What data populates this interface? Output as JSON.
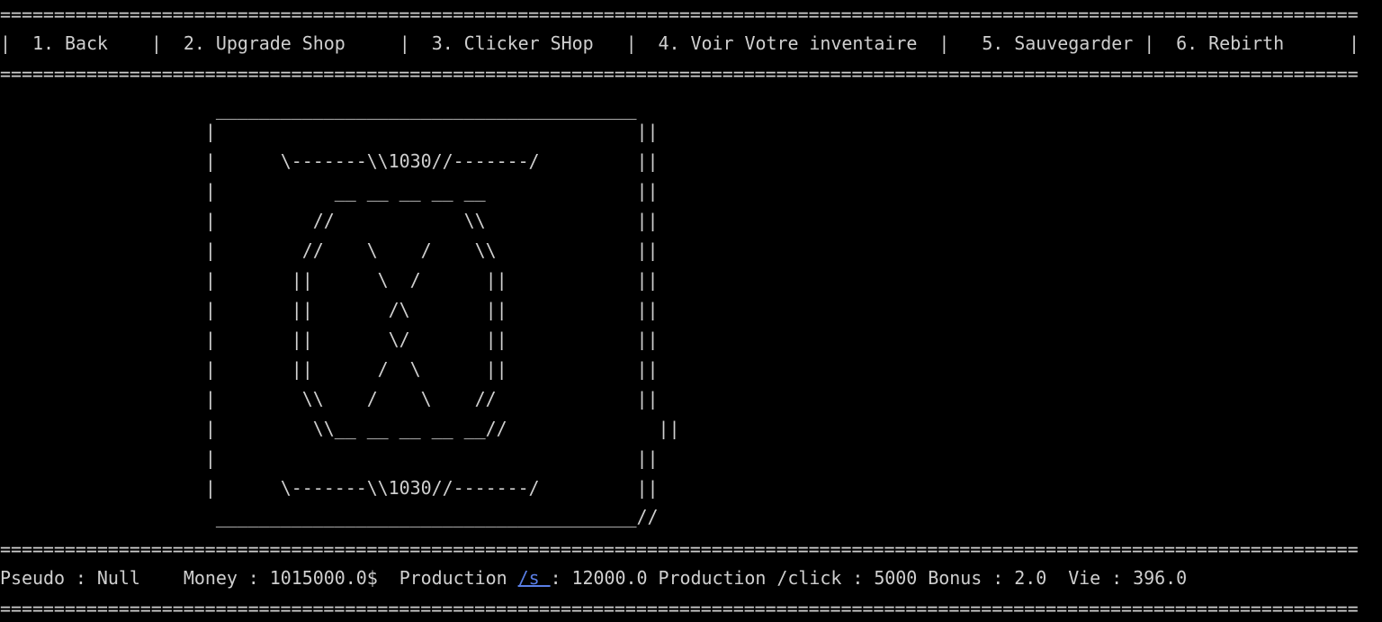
{
  "separator": "==============================================================================================================================",
  "menu": {
    "pipe": "|",
    "items": [
      {
        "label": "1. Back"
      },
      {
        "label": "2. Upgrade Shop"
      },
      {
        "label": "3. Clicker SHop"
      },
      {
        "label": "4. Voir Votre inventaire"
      },
      {
        "label": "5. Sauvegarder"
      },
      {
        "label": "6. Rebirth"
      }
    ]
  },
  "coin_art": [
    "                    _______________________________________",
    "                   |                                       ||",
    "                   |      \\-------\\\\1030//-------/         ||",
    "                   |           __ __ __ __ __              ||",
    "                   |         //            \\\\              ||",
    "                   |        //    \\    /    \\\\             ||",
    "                   |       ||      \\  /      ||            ||",
    "                   |       ||       /\\       ||            ||",
    "                   |       ||       \\/       ||            ||",
    "                   |       ||      /  \\      ||            ||",
    "                   |        \\\\    /    \\    //             ||",
    "                   |         \\\\__ __ __ __ __//              ||",
    "                   |                                       ||",
    "                   |      \\-------\\\\1030//-------/         ||",
    "                    _______________________________________//"
  ],
  "status": {
    "pseudo": "Pseudo : Null",
    "money": "Money : 1015000.0$",
    "production_label": "Production ",
    "production_link": "/s ",
    "production_value": ": 12000.0",
    "production_click": "Production /click : 5000",
    "bonus": "Bonus : 2.0",
    "vie": "Vie : 396.0"
  }
}
